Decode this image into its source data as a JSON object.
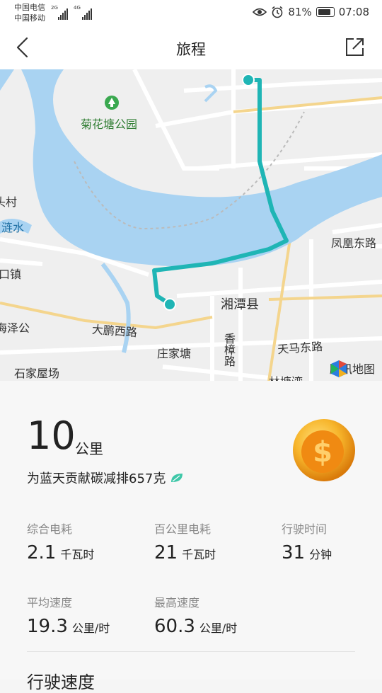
{
  "status_bar": {
    "carrier1": "中国电信",
    "carrier2": "中国移动",
    "net1": "2G",
    "net2": "4G",
    "battery_pct": "81%",
    "time": "07:08"
  },
  "header": {
    "title": "旅程"
  },
  "map": {
    "labels": {
      "park": "菊花塘公园",
      "village": "头村",
      "river": "涟水",
      "town": "口镇",
      "road_fenghuang": "凤凰东路",
      "county": "湘潭县",
      "haize": "海泽公",
      "road_dapeng": "大鹏西路",
      "road_xiangzhang": "香樟路",
      "road_tianma": "天马东路",
      "zhuangjiatang": "庄家塘",
      "shijia": "石家屋场",
      "lintang": "林塘湾"
    },
    "provider": "腾讯地图"
  },
  "trip": {
    "distance": "10",
    "distance_unit": "公里",
    "carbon_text": "为蓝天贡献碳减排657克",
    "stats": [
      {
        "label": "综合电耗",
        "value": "2.1",
        "unit": "千瓦时"
      },
      {
        "label": "百公里电耗",
        "value": "21",
        "unit": "千瓦时"
      },
      {
        "label": "行驶时间",
        "value": "31",
        "unit": "分钟"
      },
      {
        "label": "平均速度",
        "value": "19.3",
        "unit": "公里/时"
      },
      {
        "label": "最高速度",
        "value": "60.3",
        "unit": "公里/时"
      }
    ],
    "section_title": "行驶速度"
  },
  "colors": {
    "route": "#1fb5b5",
    "river": "#a9d3f2",
    "leaf": "#3ec7a8",
    "coin": "#f29a16"
  }
}
